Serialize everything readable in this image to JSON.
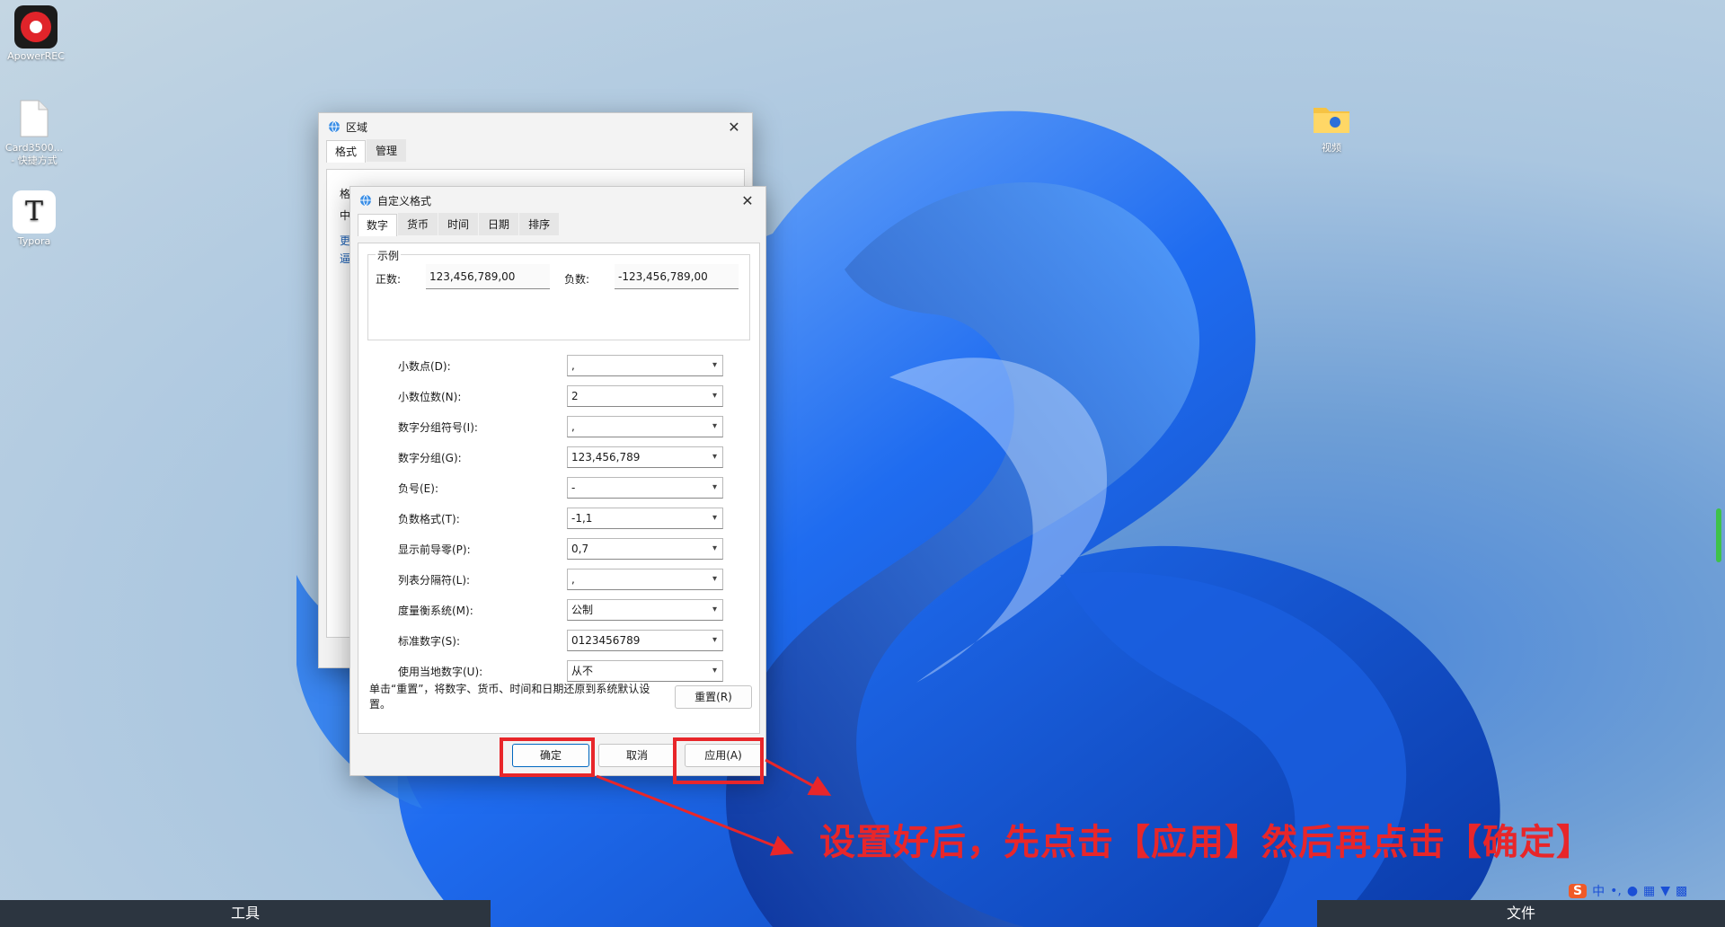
{
  "desktop": {
    "icons": [
      {
        "label": "ApowerREC"
      },
      {
        "label": "Card3500..."
      },
      {
        "label": "- 快捷方式"
      },
      {
        "label": "Typora"
      },
      {
        "label": "视频"
      }
    ]
  },
  "region_window": {
    "title": "区域",
    "tabs": [
      "格式",
      "管理"
    ],
    "partial_text": [
      "格",
      "中",
      "更",
      "逼"
    ]
  },
  "custom_format": {
    "title": "自定义格式",
    "tabs": [
      "数字",
      "货币",
      "时间",
      "日期",
      "排序"
    ],
    "sample": {
      "group_title": "示例",
      "positive_label": "正数:",
      "positive_value": "123,456,789,00",
      "negative_label": "负数:",
      "negative_value": "-123,456,789,00"
    },
    "rows": [
      {
        "label": "小数点(D):",
        "value": ","
      },
      {
        "label": "小数位数(N):",
        "value": "2"
      },
      {
        "label": "数字分组符号(I):",
        "value": ","
      },
      {
        "label": "数字分组(G):",
        "value": "123,456,789"
      },
      {
        "label": "负号(E):",
        "value": "-"
      },
      {
        "label": "负数格式(T):",
        "value": "-1,1"
      },
      {
        "label": "显示前导零(P):",
        "value": "0,7"
      },
      {
        "label": "列表分隔符(L):",
        "value": ","
      },
      {
        "label": "度量衡系统(M):",
        "value": "公制"
      },
      {
        "label": "标准数字(S):",
        "value": "0123456789"
      },
      {
        "label": "使用当地数字(U):",
        "value": "从不"
      }
    ],
    "reset_note": "单击“重置”，将数字、货币、时间和日期还原到系统默认设置。",
    "reset_button": "重置(R)",
    "ok_button": "确定",
    "cancel_button": "取消",
    "apply_button": "应用(A)"
  },
  "annotation": "设置好后，先点击【应用】然后再点击【确定】",
  "bottombar": {
    "left": "工具",
    "right": "文件"
  },
  "tray": {
    "ime_logo": "S",
    "lang": "中",
    "punct": "•,"
  },
  "colors": {
    "annotation_red": "#e8262a",
    "apowerrec_bg": "#e0242a"
  }
}
